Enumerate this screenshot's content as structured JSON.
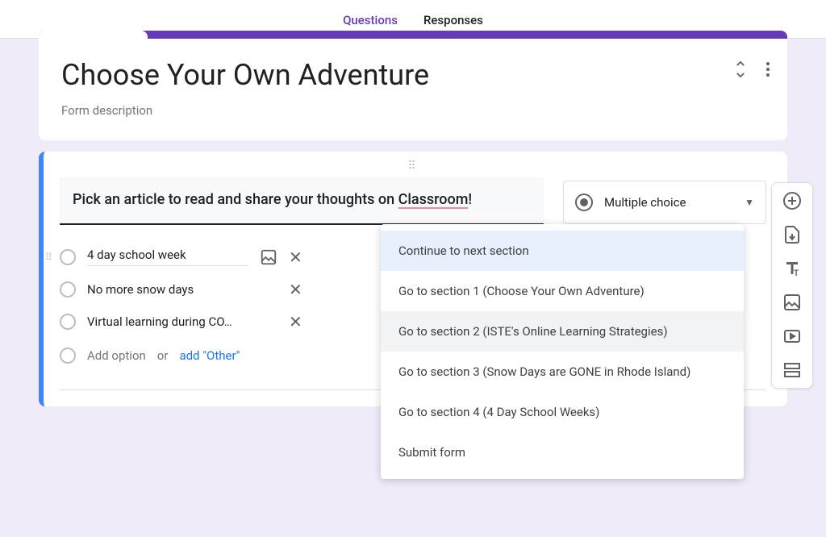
{
  "tabs": {
    "questions": "Questions",
    "responses": "Responses"
  },
  "header": {
    "title": "Choose Your Own Adventure",
    "description": "Form description"
  },
  "question": {
    "text_pre": "Pick an article to read and share your thoughts on ",
    "text_underlined": "Classroom",
    "text_post": "!",
    "type_label": "Multiple choice",
    "options": [
      {
        "label": "4 day school week"
      },
      {
        "label": "No more snow days"
      },
      {
        "label": "Virtual learning during CO…"
      }
    ],
    "add_option": "Add option",
    "or": "or",
    "add_other": "add \"Other\""
  },
  "section_menu": [
    "Continue to next section",
    "Go to section 1 (Choose Your Own Adventure)",
    "Go to section 2 (ISTE's Online Learning Strategies)",
    "Go to section 3 (Snow Days are GONE in Rhode Island)",
    "Go to section 4 (4 Day School Weeks)",
    "Submit form"
  ]
}
